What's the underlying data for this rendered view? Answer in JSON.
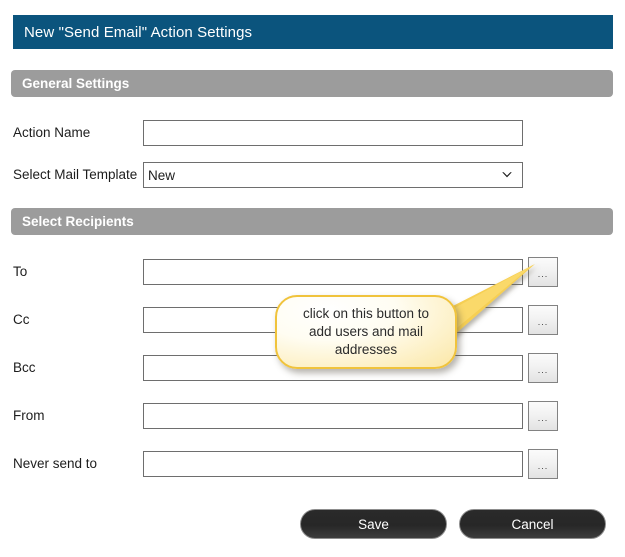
{
  "window": {
    "title": "New \"Send Email\" Action Settings"
  },
  "sections": {
    "general": {
      "heading": "General Settings",
      "fields": {
        "action_name": {
          "label": "Action Name",
          "value": "",
          "placeholder": ""
        },
        "mail_template": {
          "label": "Select Mail Template",
          "selected": "New",
          "options": [
            "New"
          ]
        }
      }
    },
    "recipients": {
      "heading": "Select Recipients",
      "browse_button_label": "...",
      "fields": [
        {
          "label": "To",
          "value": "",
          "placeholder": ""
        },
        {
          "label": "Cc",
          "value": "",
          "placeholder": ""
        },
        {
          "label": "Bcc",
          "value": "",
          "placeholder": ""
        },
        {
          "label": "From",
          "value": "",
          "placeholder": ""
        },
        {
          "label": "Never send to",
          "value": "",
          "placeholder": ""
        }
      ]
    }
  },
  "callout": {
    "text": "click on this button to add users and mail addresses",
    "line1": "click on this button to",
    "line2": "add users and mail",
    "line3": "addresses"
  },
  "footer": {
    "save_label": "Save",
    "cancel_label": "Cancel"
  },
  "colors": {
    "title_bar": "#0b547d",
    "section_header": "#9c9c9c",
    "callout_border": "#f0c33c",
    "callout_fill": "#fdf1c8",
    "footer_button": "#2a2a2a",
    "page_background": "#ffffff"
  },
  "icons": {
    "chevron_down": "chevron-down-icon",
    "ellipsis": "ellipsis-icon"
  }
}
